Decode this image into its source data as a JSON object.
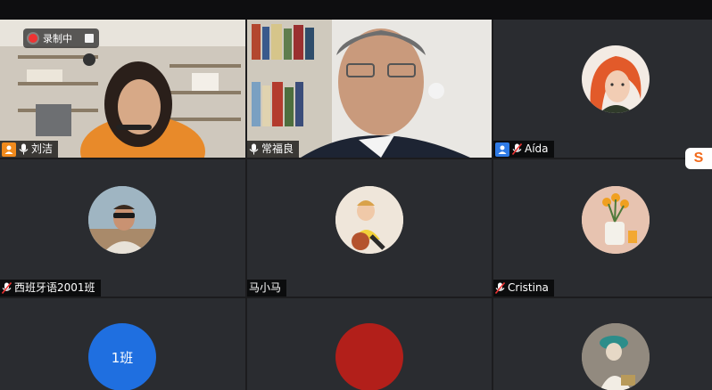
{
  "recording": {
    "label": "录制中"
  },
  "participants": [
    {
      "name": "刘洁",
      "mic": "on",
      "host": true,
      "badge_color": "#f08a1c"
    },
    {
      "name": "常福良",
      "mic": "on"
    },
    {
      "name": "Aída",
      "mic": "muted",
      "host": true,
      "badge_color": "#2f7ae5"
    },
    {
      "name": "西班牙语2001班",
      "mic": "muted"
    },
    {
      "name": "马小马",
      "mic": "none"
    },
    {
      "name": "Cristina",
      "mic": "muted"
    },
    {
      "name": "",
      "avatar_text": "1班",
      "avatar_color": "#1f6fe0"
    },
    {
      "name": "",
      "avatar_color": "#b21f1a"
    },
    {
      "name": ""
    }
  ],
  "colors": {
    "active_speaker": "#3fbf5a",
    "tile_bg": "#2a2c30"
  },
  "overlay_logo": "S"
}
